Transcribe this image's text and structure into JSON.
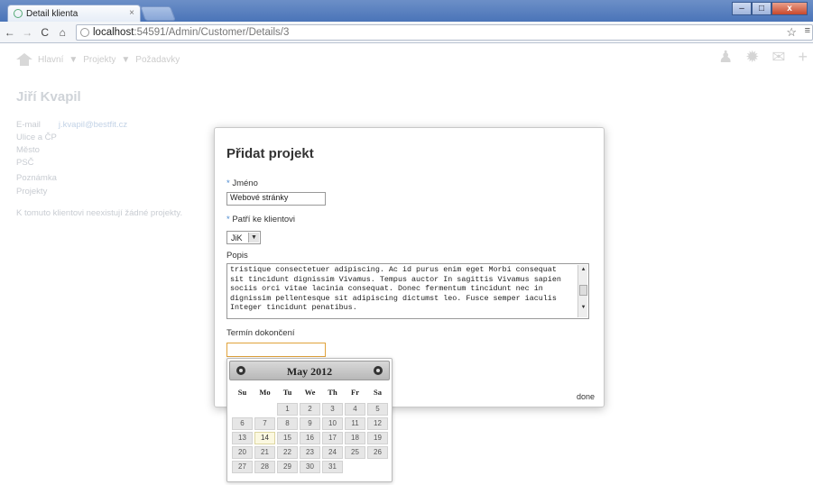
{
  "browser": {
    "tab_title": "Detail klienta",
    "tab_close": "×",
    "url_host": "localhost",
    "url_rest": ":54591/Admin/Customer/Details/3",
    "back": "←",
    "forward": "→",
    "reload": "C",
    "home": "⌂",
    "star": "☆",
    "wrench": "≡",
    "win_min": "–",
    "win_max": "□",
    "win_close": "x"
  },
  "appnav": {
    "items": [
      "Hlavní",
      "▼",
      "Projekty",
      "▼",
      "Požadavky"
    ],
    "right_icons": [
      "user-icon",
      "gear-icon",
      "mail-icon",
      "plus-icon"
    ],
    "right_glyphs": [
      "♟",
      "✹",
      "✉",
      "+"
    ]
  },
  "page": {
    "title": "Jiří Kvapil",
    "info": [
      {
        "label": "E-mail",
        "value": "j.kvapil@bestfit.cz"
      },
      {
        "label": "Ulice a ČP",
        "value": ""
      },
      {
        "label": "Město",
        "value": ""
      },
      {
        "label": "PSČ",
        "value": ""
      },
      {
        "label": "Poznámka",
        "value": ""
      },
      {
        "label": "Projekty",
        "value": ""
      }
    ],
    "no_projects": "K tomuto klientovi neexistují žádné projekty."
  },
  "modal": {
    "title": "Přidat projekt",
    "required_mark": "*",
    "name_label": "Jméno",
    "name_value": "Webové stránky",
    "client_label": "Patří ke klientovi",
    "client_value": "JiK",
    "client_arrow": "▼",
    "desc_label": "Popis",
    "desc_value": "tristique consectetuer adipiscing. Ac id purus enim eget Morbi consequat sit tincidunt dignissim Vivamus. Tempus auctor In sagittis Vivamus sapien sociis orci vitae lacinia consequat. Donec fermentum tincidunt nec in dignissim pellentesque sit adipiscing dictumst leo. Fusce semper iaculis Integer tincidunt penatibus.",
    "date_label": "Termín dokončení",
    "done_label": "done"
  },
  "datepicker": {
    "month_year": "May 2012",
    "day_names": [
      "Su",
      "Mo",
      "Tu",
      "We",
      "Th",
      "Fr",
      "Sa"
    ],
    "weeks": [
      [
        "",
        "",
        "1",
        "2",
        "3",
        "4",
        "5"
      ],
      [
        "6",
        "7",
        "8",
        "9",
        "10",
        "11",
        "12"
      ],
      [
        "13",
        "14",
        "15",
        "16",
        "17",
        "18",
        "19"
      ],
      [
        "20",
        "21",
        "22",
        "23",
        "24",
        "25",
        "26"
      ],
      [
        "27",
        "28",
        "29",
        "30",
        "31",
        "",
        ""
      ]
    ],
    "today": "14"
  }
}
